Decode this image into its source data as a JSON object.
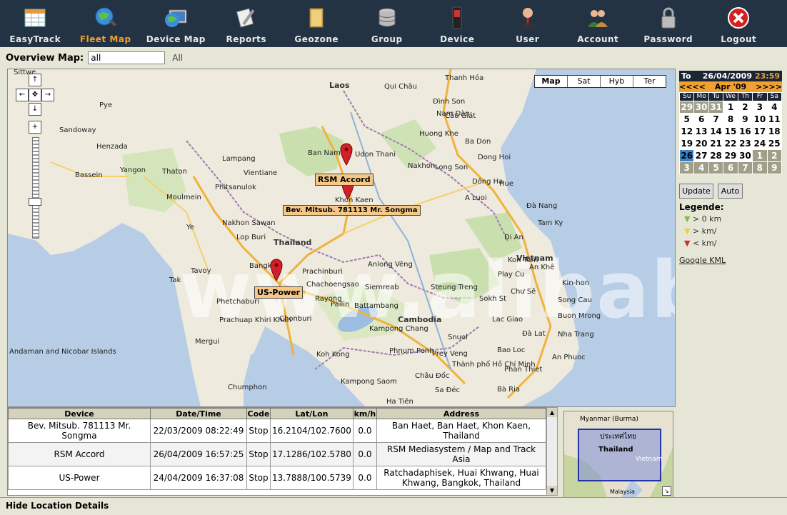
{
  "nav": [
    {
      "label": "EasyTrack",
      "icon": "table-icon"
    },
    {
      "label": "Fleet Map",
      "icon": "globe-search-icon",
      "active": true
    },
    {
      "label": "Device Map",
      "icon": "globe-monitor-icon"
    },
    {
      "label": "Reports",
      "icon": "report-pen-icon"
    },
    {
      "label": "Geozone",
      "icon": "folder-icon"
    },
    {
      "label": "Group",
      "icon": "database-icon"
    },
    {
      "label": "Device",
      "icon": "mobile-phone-icon"
    },
    {
      "label": "User",
      "icon": "user-icon"
    },
    {
      "label": "Account",
      "icon": "users-group-icon"
    },
    {
      "label": "Password",
      "icon": "padlock-icon"
    },
    {
      "label": "Logout",
      "icon": "close-circle-icon"
    }
  ],
  "overview": {
    "label": "Overview Map:",
    "value": "all",
    "all_text": "All"
  },
  "map": {
    "types": [
      "Map",
      "Sat",
      "Hyb",
      "Ter"
    ],
    "markers": [
      {
        "label": "RSM Accord"
      },
      {
        "label": "Bev. Mitsub. 781113 Mr. Songma"
      },
      {
        "label": "US-Power"
      }
    ],
    "countries": [
      "Laos",
      "Thailand",
      "Vietnam",
      "Cambodia"
    ],
    "cities": [
      "Sittwe",
      "Pye",
      "Sandoway",
      "Henzada",
      "Bassein",
      "Yangon",
      "Moulmein",
      "Thaton",
      "Ye",
      "Tavoy",
      "Mergui",
      "Qui Châu",
      "Thanh Hóa",
      "Đình Son",
      "Cầu Giát",
      "Nam Đàn",
      "Huong Khe",
      "Ba Don",
      "Dong Hoi",
      "Long Son",
      "Dông Ha",
      "Hue",
      "A Luoi",
      "Đà Nang",
      "Tam Ky",
      "Vientiane",
      "Udon Thani",
      "Nakhon",
      "Khon Kaen",
      "Ban Nam",
      "Lampang",
      "Phitsanulok",
      "Nakhon Sawan",
      "Lop Buri",
      "Bangkok",
      "Chonburi",
      "Siemreab",
      "Battambang",
      "Pailin",
      "Kampong Chang",
      "Koh Kong",
      "Phnum Penh",
      "Prey Veng",
      "Kampong Saom",
      "Ha Tiên",
      "Châu Đốc",
      "Sa Đéc",
      "Bà Ria",
      "Thành phố Hồ Chí Minh",
      "Phan Thiet",
      "Bao Loc",
      "Đà Lat",
      "Nha Trang",
      "An Phuoc",
      "Buon Mrong",
      "Lac Giao",
      "Song Cau",
      "Kin-hon",
      "Chư Sê",
      "Play Cu",
      "An Khê",
      "Kon Tum",
      "Di An",
      "Steung Treng",
      "Sokh St",
      "Snuol",
      "Anlong Vêng",
      "Prachinburi",
      "Chachoengsao",
      "Rayong",
      "Tak",
      "Phetchaburi",
      "Prachuap Khiri Khan",
      "Chumphon",
      "Andaman and Nicobar Islands"
    ],
    "watermark": "www.alibaba.com"
  },
  "calendar": {
    "to_label": "To",
    "date": "26/04/2009",
    "time": "23:59",
    "prev": "<<<<",
    "month": "Apr '09",
    "next": ">>>>",
    "dow": [
      "Su",
      "Mo",
      "Tu",
      "We",
      "Th",
      "Fr",
      "Sa"
    ],
    "days": [
      {
        "d": "29",
        "out": true
      },
      {
        "d": "30",
        "out": true
      },
      {
        "d": "31",
        "out": true
      },
      {
        "d": "1"
      },
      {
        "d": "2"
      },
      {
        "d": "3"
      },
      {
        "d": "4"
      },
      {
        "d": "5"
      },
      {
        "d": "6"
      },
      {
        "d": "7"
      },
      {
        "d": "8"
      },
      {
        "d": "9"
      },
      {
        "d": "10"
      },
      {
        "d": "11"
      },
      {
        "d": "12"
      },
      {
        "d": "13"
      },
      {
        "d": "14"
      },
      {
        "d": "15"
      },
      {
        "d": "16"
      },
      {
        "d": "17"
      },
      {
        "d": "18"
      },
      {
        "d": "19"
      },
      {
        "d": "20"
      },
      {
        "d": "21"
      },
      {
        "d": "22"
      },
      {
        "d": "23"
      },
      {
        "d": "24"
      },
      {
        "d": "25"
      },
      {
        "d": "26",
        "today": true
      },
      {
        "d": "27"
      },
      {
        "d": "28"
      },
      {
        "d": "29"
      },
      {
        "d": "30"
      },
      {
        "d": "1",
        "out": true
      },
      {
        "d": "2",
        "out": true
      },
      {
        "d": "3",
        "out": true
      },
      {
        "d": "4",
        "out": true
      },
      {
        "d": "5",
        "out": true
      },
      {
        "d": "6",
        "out": true
      },
      {
        "d": "7",
        "out": true
      },
      {
        "d": "8",
        "out": true
      },
      {
        "d": "9",
        "out": true
      }
    ],
    "update_label": "Update",
    "auto_label": "Auto"
  },
  "legend": {
    "title": "Legende:",
    "items": [
      {
        "text": "> 0 km",
        "color": "#7cc04a"
      },
      {
        "text": "> km/",
        "color": "#e8d23a"
      },
      {
        "text": "< km/",
        "color": "#d22c2c"
      }
    ],
    "kml": "Google KML"
  },
  "table": {
    "headers": [
      "Device",
      "Date/Time",
      "Code",
      "Lat/Lon",
      "km/h",
      "Address"
    ],
    "rows": [
      [
        "Bev. Mitsub. 781113 Mr. Songma",
        "22/03/2009 08:22:49",
        "Stop",
        "16.2104/102.7600",
        "0.0",
        "Ban Haet, Ban Haet, Khon Kaen, Thailand"
      ],
      [
        "RSM Accord",
        "26/04/2009 16:57:25",
        "Stop",
        "17.1286/102.5780",
        "0.0",
        "RSM Mediasystem / Map and Track Asia"
      ],
      [
        "US-Power",
        "24/04/2009 16:37:08",
        "Stop",
        "13.7888/100.5739",
        "0.0",
        "Ratchadaphisek, Huai Khwang, Huai Khwang, Bangkok, Thailand"
      ]
    ]
  },
  "minimap": {
    "labels": [
      "Myanmar (Burma)",
      "ประเทศไทย",
      "Thailand",
      "Vietnam",
      "Malaysia"
    ]
  },
  "footer": {
    "hide_label": "Hide Location Details"
  }
}
